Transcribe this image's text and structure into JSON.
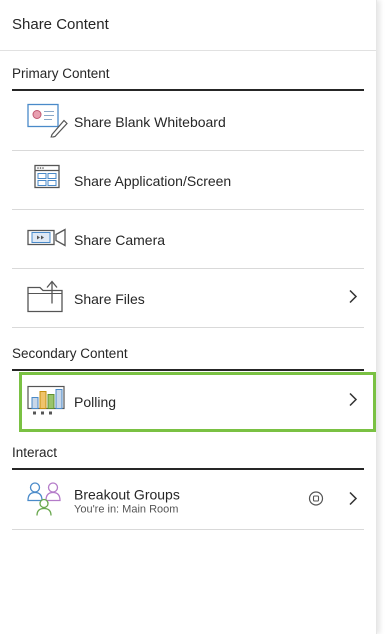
{
  "panel": {
    "title": "Share Content"
  },
  "sections": {
    "primary": {
      "label": "Primary Content"
    },
    "secondary": {
      "label": "Secondary Content"
    },
    "interact": {
      "label": "Interact"
    }
  },
  "items": {
    "whiteboard": {
      "label": "Share Blank Whiteboard",
      "icon": "whiteboard-icon"
    },
    "application": {
      "label": "Share Application/Screen",
      "icon": "application-screen-icon"
    },
    "camera": {
      "label": "Share Camera",
      "icon": "camera-icon"
    },
    "files": {
      "label": "Share Files",
      "icon": "files-icon"
    },
    "polling": {
      "label": "Polling",
      "icon": "polling-icon"
    },
    "breakout": {
      "label": "Breakout Groups",
      "sublabel": "You're in: Main Room",
      "icon": "breakout-groups-icon"
    }
  },
  "colors": {
    "highlight": "#7ac143",
    "text": "#262626",
    "accent_blue": "#4a8ac9"
  }
}
